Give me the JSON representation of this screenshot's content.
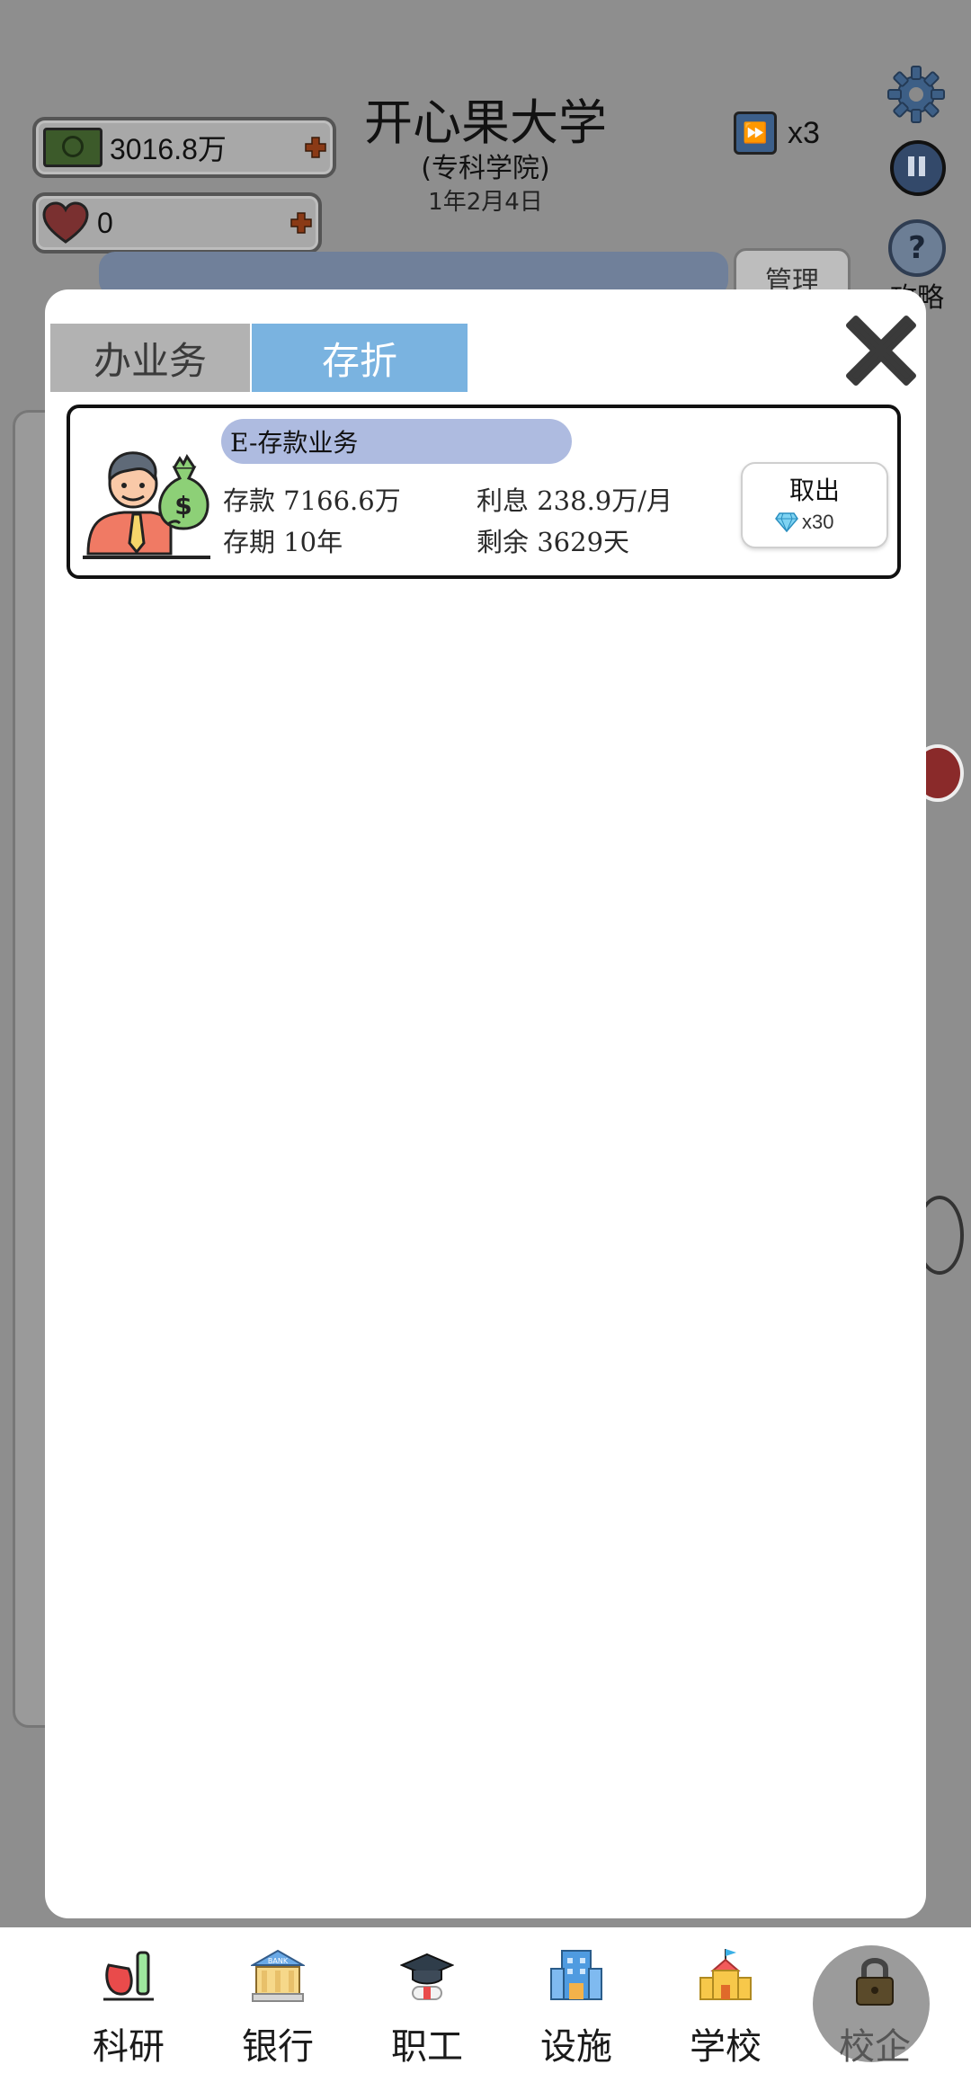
{
  "hud": {
    "school_name": "开心果大学",
    "school_type": "(专科学院)",
    "date": "1年2月4日",
    "money": "3016.8万",
    "hearts": "0",
    "speed": "x3",
    "help_label": "攻略",
    "manage_label": "管理"
  },
  "modal": {
    "tabs": [
      {
        "label": "办业务",
        "active": false
      },
      {
        "label": "存折",
        "active": true
      }
    ],
    "deposits": [
      {
        "title": "E-存款业务",
        "amount": "存款 7166.6万",
        "interest": "利息 238.9万/月",
        "term": "存期 10年",
        "remaining": "剩余 3629天",
        "withdraw_label": "取出",
        "withdraw_cost": "x30"
      }
    ]
  },
  "nav": [
    {
      "label": "科研",
      "icon": "flask-icon"
    },
    {
      "label": "银行",
      "icon": "bank-icon"
    },
    {
      "label": "职工",
      "icon": "graduation-cap-icon"
    },
    {
      "label": "设施",
      "icon": "building-icon"
    },
    {
      "label": "学校",
      "icon": "school-icon"
    },
    {
      "label": "校企",
      "icon": "lock-icon",
      "locked": true
    }
  ],
  "colors": {
    "tab_active": "#7ab3e0",
    "tab_inactive": "#b2b2b2",
    "card_title_bg": "#aebbe0"
  }
}
